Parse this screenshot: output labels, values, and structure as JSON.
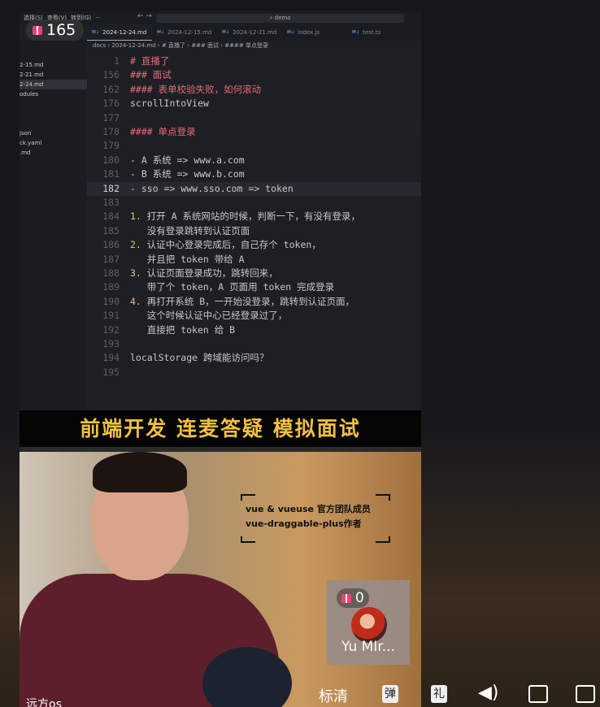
{
  "vscode": {
    "menu": [
      "选择(S)",
      "查看(V)",
      "转到(G)",
      "···"
    ],
    "search": "⌕ demo",
    "tabs": [
      "2024-12-24.md",
      "2024-12-15.md",
      "2024-12-21.md",
      "index.js",
      "test.ts"
    ],
    "breadcrumb": "docs › 2024-12-24.md › # 直播了 › ### 面试 › #### 单点登录",
    "sidebar": [
      "",
      "",
      "2-15.md",
      "2-21.md",
      "2-24.md",
      "odules",
      "",
      "",
      "",
      "json",
      "ck.yaml",
      ".md"
    ],
    "lines": [
      {
        "n": "1",
        "t": "# 直播了",
        "k": "h"
      },
      {
        "n": "156",
        "t": "### 面试",
        "k": "h"
      },
      {
        "n": "162",
        "t": "#### 表单校验失败，如何滚动",
        "k": "h"
      },
      {
        "n": "176",
        "t": "scrollIntoView",
        "k": ""
      },
      {
        "n": "177",
        "t": "",
        "k": ""
      },
      {
        "n": "178",
        "t": "#### 单点登录",
        "k": "h"
      },
      {
        "n": "179",
        "t": "",
        "k": ""
      },
      {
        "n": "180",
        "t": "- A 系统 => www.a.com",
        "k": ""
      },
      {
        "n": "181",
        "t": "- B 系统 => www.b.com",
        "k": ""
      },
      {
        "n": "182",
        "t": "- sso => www.sso.com => token",
        "k": "cur"
      },
      {
        "n": "183",
        "t": "",
        "k": ""
      },
      {
        "n": "184",
        "p": "1.",
        "t": " 打开 A 系统网站的时候，判断一下，有没有登录，",
        "k": "num"
      },
      {
        "n": "185",
        "t": "   没有登录跳转到认证页面",
        "k": ""
      },
      {
        "n": "186",
        "p": "2.",
        "t": " 认证中心登录完成后，自己存个 token，",
        "k": "num"
      },
      {
        "n": "187",
        "t": "   并且把 token 带给 A",
        "k": ""
      },
      {
        "n": "188",
        "p": "3.",
        "t": " 认证页面登录成功，跳转回来，",
        "k": "num"
      },
      {
        "n": "189",
        "t": "   带了个 token，A 页面用 token 完成登录",
        "k": ""
      },
      {
        "n": "190",
        "p": "4.",
        "t": " 再打开系统 B，一开始没登录，跳转到认证页面，",
        "k": "num"
      },
      {
        "n": "191",
        "t": "   这个时候认证中心已经登录过了，",
        "k": ""
      },
      {
        "n": "192",
        "t": "   直接把 token 给 B",
        "k": ""
      },
      {
        "n": "193",
        "t": "",
        "k": ""
      },
      {
        "n": "194",
        "t": "localStorage 跨域能访问吗？",
        "k": ""
      },
      {
        "n": "195",
        "t": "",
        "k": ""
      }
    ]
  },
  "banner": "前端开发 连麦答疑 模拟面试",
  "sign": [
    "vue & vueuse 官方团队成员",
    "vue-draggable-plus作者"
  ],
  "gift_count": "165",
  "guest": {
    "gifts": "0",
    "name": "Yu MIr..."
  },
  "caption": "远方os",
  "controls": {
    "quality": "标清",
    "danmaku": "弹",
    "gift": "礼",
    "volume": "volume",
    "pip": "pip",
    "fullscreen": "fullscreen"
  }
}
